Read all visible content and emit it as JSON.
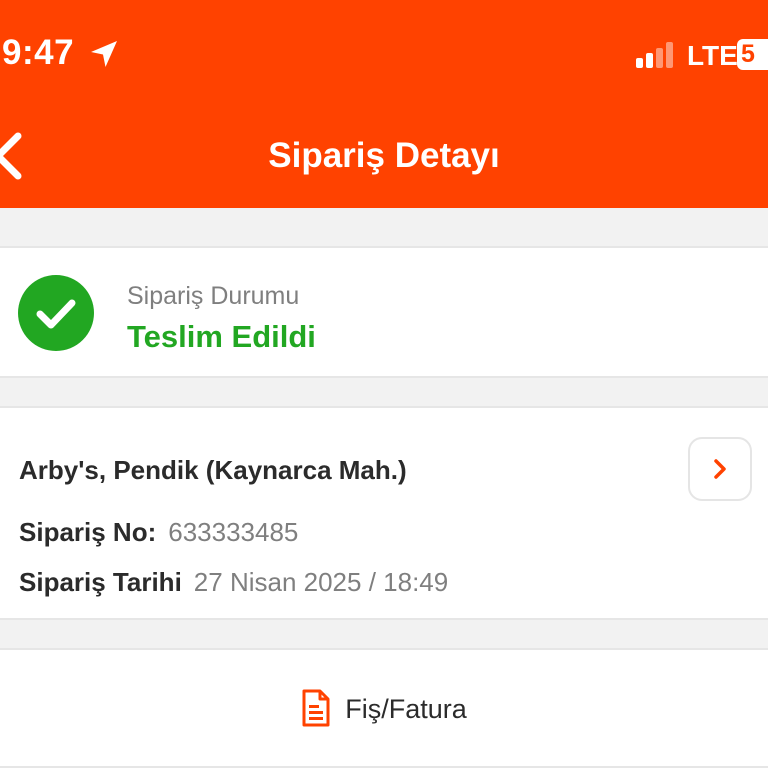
{
  "status_bar": {
    "time": "9:47",
    "network": "LTE",
    "battery": "5"
  },
  "nav": {
    "title": "Sipariş Detayı"
  },
  "order_status": {
    "label": "Sipariş Durumu",
    "value": "Teslim Edildi"
  },
  "order": {
    "restaurant": "Arby's, Pendik (Kaynarca Mah.)",
    "number_label": "Sipariş No:",
    "number_value": "633333485",
    "date_label": "Sipariş Tarihi",
    "date_value": "27 Nisan 2025 / 18:49"
  },
  "receipt": {
    "label": "Fiş/Fatura"
  },
  "colors": {
    "brand": "#ff4200",
    "success": "#22a722",
    "muted_text": "#7f7f7f",
    "text": "#2b2b2b"
  },
  "icons": [
    "location-arrow-icon",
    "signal-bars-icon",
    "battery-icon",
    "chevron-left-icon",
    "check-circle-icon",
    "chevron-right-icon",
    "document-icon"
  ]
}
